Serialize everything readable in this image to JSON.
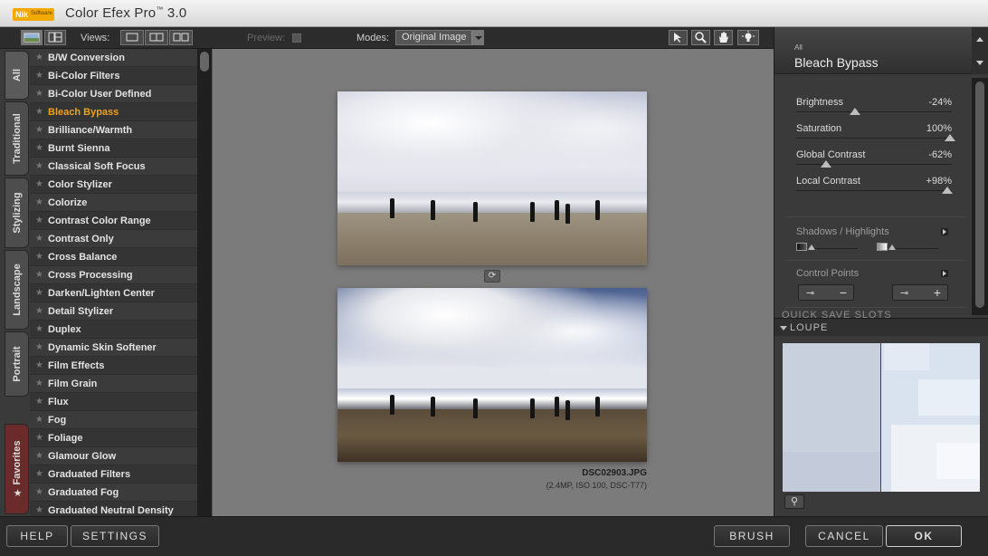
{
  "app": {
    "title": "Color Efex Pro",
    "trademark": "™",
    "version": "3.0",
    "logo_text": "Nik",
    "logo_subtext": "Software"
  },
  "toolbar": {
    "views_label": "Views:",
    "preview_label": "Preview:",
    "modes_label": "Modes:",
    "modes_value": "Original Image"
  },
  "tabs": [
    {
      "label": "All"
    },
    {
      "label": "Traditional"
    },
    {
      "label": "Stylizing"
    },
    {
      "label": "Landscape"
    },
    {
      "label": "Portrait"
    },
    {
      "label": "Favorites"
    }
  ],
  "filters": [
    "B/W Conversion",
    "Bi-Color Filters",
    "Bi-Color User Defined",
    "Bleach Bypass",
    "Brilliance/Warmth",
    "Burnt Sienna",
    "Classical Soft Focus",
    "Color Stylizer",
    "Colorize",
    "Contrast Color Range",
    "Contrast Only",
    "Cross Balance",
    "Cross Processing",
    "Darken/Lighten Center",
    "Detail Stylizer",
    "Duplex",
    "Dynamic Skin Softener",
    "Film Effects",
    "Film Grain",
    "Flux",
    "Fog",
    "Foliage",
    "Glamour Glow",
    "Graduated Filters",
    "Graduated Fog",
    "Graduated Neutral Density"
  ],
  "active_filter_index": 3,
  "file": {
    "name": "DSC02903.JPG",
    "info": "(2.4MP, ISO 100, DSC-T77)"
  },
  "panel": {
    "category": "All",
    "filter_name": "Bleach Bypass",
    "sliders": [
      {
        "label": "Brightness",
        "value": "-24%",
        "fraction": 0.38
      },
      {
        "label": "Saturation",
        "value": "100%",
        "fraction": 0.99
      },
      {
        "label": "Global Contrast",
        "value": "-62%",
        "fraction": 0.19
      },
      {
        "label": "Local Contrast",
        "value": "+98%",
        "fraction": 0.97
      }
    ],
    "shadows_highlights_label": "Shadows / Highlights",
    "shadows_fraction": 0.05,
    "highlights_fraction": 0.05,
    "control_points_label": "Control Points",
    "cp_minus": "−",
    "cp_plus": "+",
    "quick_save_label": "QUICK SAVE SLOTS",
    "loupe_label": "LOUPE"
  },
  "bottom": {
    "help": "HELP",
    "settings": "SETTINGS",
    "brush": "BRUSH",
    "cancel": "CANCEL",
    "ok": "OK"
  }
}
